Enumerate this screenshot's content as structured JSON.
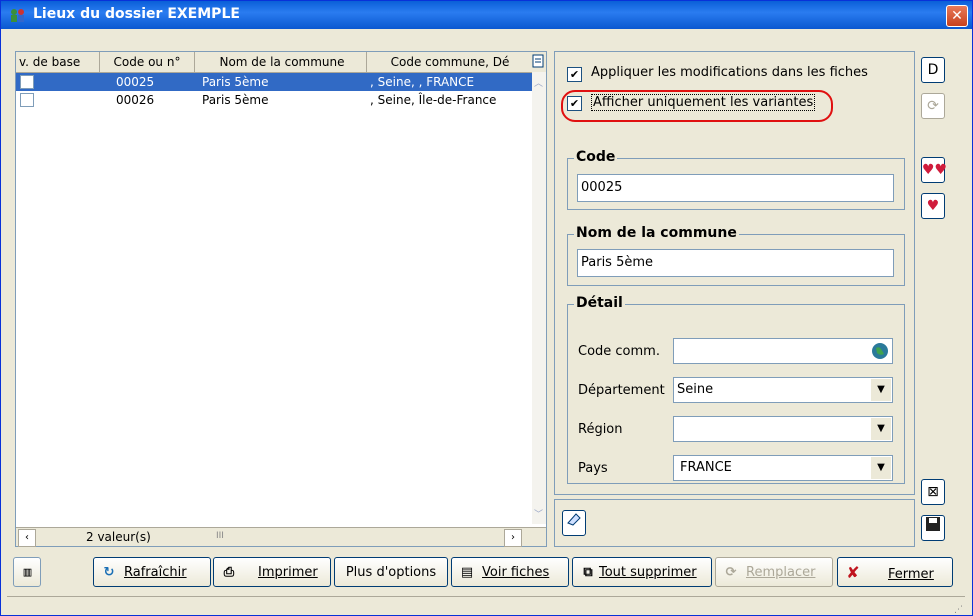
{
  "window": {
    "title": "Lieux du dossier EXEMPLE",
    "close_label": "x"
  },
  "list": {
    "columns": [
      "v. de base",
      "Code ou n°",
      "Nom de la commune",
      "Code commune, Dé"
    ],
    "rows": [
      {
        "code": "00025",
        "name": "Paris 5ème",
        "detail": ", Seine, , FRANCE",
        "selected": true
      },
      {
        "code": "00026",
        "name": "Paris 5ème",
        "detail": ", Seine, Île-de-France",
        "selected": false
      }
    ],
    "count_text": "2 valeur(s)",
    "scroll_grip": "III"
  },
  "options": {
    "apply_label": "Appliquer les modifications dans les fiches",
    "apply_checked": true,
    "variants_label": "Afficher uniquement les variantes",
    "variants_checked": true
  },
  "code_group": {
    "title": "Code",
    "value": "00025"
  },
  "name_group": {
    "title": "Nom de la commune",
    "value": "Paris 5ème"
  },
  "detail_group": {
    "title": "Détail",
    "code_comm_label": "Code comm.",
    "code_comm_value": "",
    "departement_label": "Département",
    "departement_value": "Seine",
    "region_label": "Région",
    "region_value": "",
    "pays_label": "Pays",
    "pays_value": "FRANCE"
  },
  "buttons": {
    "rafraichir": "Rafraîchir",
    "imprimer": "Imprimer",
    "plus_options": "Plus d'options",
    "voir_fiches": "Voir fiches",
    "tout_supprimer": "Tout supprimer",
    "remplacer": "Remplacer",
    "fermer": "Fermer"
  },
  "colors": {
    "titlebar": "#0a5fd8",
    "selection": "#316ac5",
    "highlight_circle": "#e01010"
  }
}
